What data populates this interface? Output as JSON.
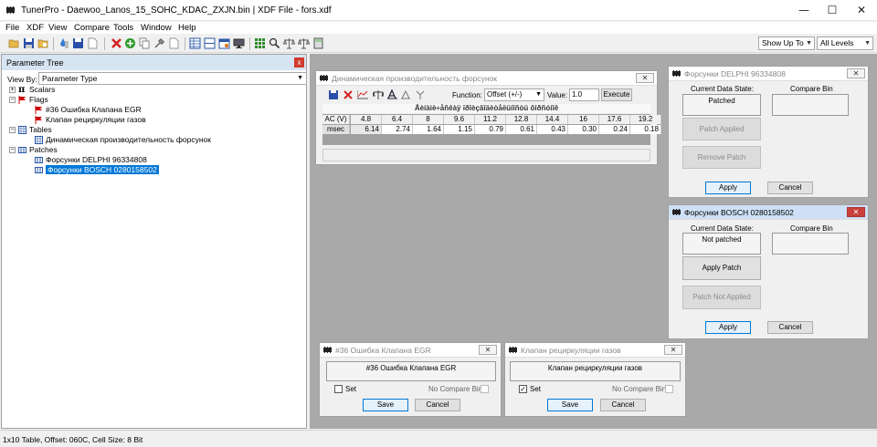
{
  "window": {
    "title": "TunerPro - Daewoo_Lanos_15_SOHC_KDAC_ZXJN.bin | XDF File - fors.xdf",
    "minimize": "—",
    "maximize": "☐",
    "close": "✕"
  },
  "menu": [
    "File",
    "XDF",
    "View",
    "Compare",
    "Tools",
    "Window",
    "Help"
  ],
  "toolbar": {
    "show_up_to": "Show Up To",
    "all_levels": "All Levels"
  },
  "parameter_tree": {
    "title": "Parameter Tree",
    "close": "x",
    "view_by_label": "View By:",
    "view_by_value": "Parameter Type",
    "items": [
      {
        "label": "Scalars",
        "plus": "+"
      },
      {
        "label": "Flags",
        "plus": "−"
      },
      {
        "label": "#36 Ошибка Клапана EGR"
      },
      {
        "label": "Клапан рециркуляции газов"
      },
      {
        "label": "Tables",
        "plus": "−"
      },
      {
        "label": "Динамическая производительность форсунок"
      },
      {
        "label": "Patches",
        "plus": "−"
      },
      {
        "label": "Форсунки DELPHI 96334808"
      },
      {
        "label": "Форсунки BOSCH 0280158502"
      }
    ]
  },
  "table_window": {
    "title": "Динамическая производительность форсунок",
    "close": "✕",
    "function_label": "Function:",
    "function_value": "Offset (+/-)",
    "value_label": "Value:",
    "value_value": "1.0",
    "execute": "Execute",
    "garbled_title": "Äèíàìè÷åñêàÿ ïðîèçâîäèòåëüíîñòü ôîðñóíîê",
    "row_header": "AC (V)",
    "row_label": "msec",
    "columns": [
      "4.8",
      "6.4",
      "8",
      "9.6",
      "11.2",
      "12.8",
      "14.4",
      "16",
      "17.6",
      "19.2"
    ],
    "values": [
      "6.14",
      "2.74",
      "1.64",
      "1.15",
      "0.79",
      "0.61",
      "0.43",
      "0.30",
      "0.24",
      "0.18"
    ]
  },
  "delphi": {
    "title": "Форсунки DELPHI 96334808",
    "close": "✕",
    "state_label": "Current Data State:",
    "compare_label": "Compare Bin",
    "state_value": "Patched",
    "patch_applied": "Patch Applied",
    "remove_patch": "Remove Patch",
    "apply": "Apply",
    "cancel": "Cancel"
  },
  "bosch": {
    "title": "Форсунки BOSCH 0280158502",
    "close": "✕",
    "state_label": "Current Data State:",
    "compare_label": "Compare Bin",
    "state_value": "Not patched",
    "apply_patch": "Apply Patch",
    "patch_not_applied": "Patch Not Applied",
    "apply": "Apply",
    "cancel": "Cancel"
  },
  "flag_egr": {
    "title": "#36 Ошибка Клапана EGR",
    "close": "✕",
    "label": "#36 Ошибка Клапана EGR",
    "set": "Set",
    "no_compare": "No Compare Bin",
    "save": "Save",
    "cancel": "Cancel",
    "checked": ""
  },
  "flag_recirc": {
    "title": "Клапан рециркуляции газов",
    "close": "✕",
    "label": "Клапан рециркуляции газов",
    "set": "Set",
    "no_compare": "No Compare Bin",
    "save": "Save",
    "cancel": "Cancel",
    "checked": "✓"
  },
  "status": "1x10 Table, Offset: 060C,  Cell Size: 8 Bit",
  "colors": {
    "mdi_background": "#a9a9a9",
    "selection": "#0078d7",
    "flag_red": "#cc0000"
  }
}
